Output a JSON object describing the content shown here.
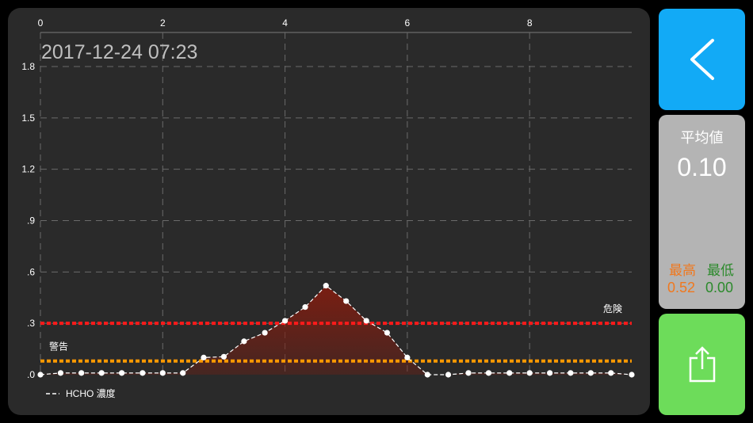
{
  "timestamp": "2017-12-24 07:23",
  "stats": {
    "avg_label": "平均値",
    "avg_value": "0.10",
    "max_label": "最高",
    "max_value": "0.52",
    "min_label": "最低",
    "min_value": "0.00"
  },
  "icons": {
    "back": "chevron-left-icon",
    "share": "share-icon"
  },
  "colors": {
    "panel_bg": "#2a2a2a",
    "back_button": "#12aaf6",
    "stats_panel": "#b4b4b4",
    "share_button": "#6ddc5a",
    "max_text": "#f0781e",
    "min_text": "#2c8a2c",
    "danger_line": "#ff1a1a",
    "warning_line": "#ff9900",
    "series_line": "#ffffff",
    "series_fill": "#7a1e12"
  },
  "chart_data": {
    "type": "line",
    "title": "",
    "x_ticks": [
      "0",
      "2",
      "4",
      "6",
      "8"
    ],
    "y_ticks": [
      ".0",
      ".3",
      ".6",
      ".9",
      "1.2",
      "1.5",
      "1.8"
    ],
    "xlim": [
      0,
      9.67
    ],
    "ylim": [
      0,
      1.8
    ],
    "grid": true,
    "series": [
      {
        "name": "HCHO 濃度",
        "x": [
          0,
          0.33,
          0.67,
          1,
          1.33,
          1.67,
          2,
          2.33,
          2.67,
          3,
          3.33,
          3.67,
          4,
          4.33,
          4.67,
          5,
          5.33,
          5.67,
          6,
          6.33,
          6.67,
          7,
          7.33,
          7.67,
          8,
          8.33,
          8.67,
          9,
          9.33,
          9.67
        ],
        "y": [
          0,
          0.01,
          0.01,
          0.01,
          0.01,
          0.01,
          0.01,
          0.01,
          0.1,
          0.105,
          0.195,
          0.245,
          0.315,
          0.395,
          0.52,
          0.43,
          0.315,
          0.245,
          0.1,
          0,
          0,
          0.01,
          0.01,
          0.01,
          0.01,
          0.01,
          0.01,
          0.01,
          0.01,
          0
        ]
      }
    ],
    "limit_lines": [
      {
        "name": "危険",
        "value": 0.3
      },
      {
        "name": "警告",
        "value": 0.08
      }
    ],
    "legend_position": "bottom-left"
  }
}
